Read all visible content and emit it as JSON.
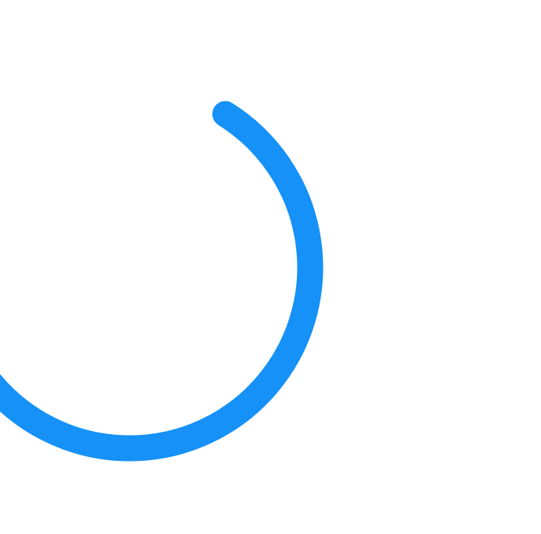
{
  "loader": {
    "icon": "loading-spinner-icon",
    "progress_fraction": 0.55,
    "colors": {
      "arc": "#1591F7",
      "background": "#FFFFFF"
    }
  }
}
